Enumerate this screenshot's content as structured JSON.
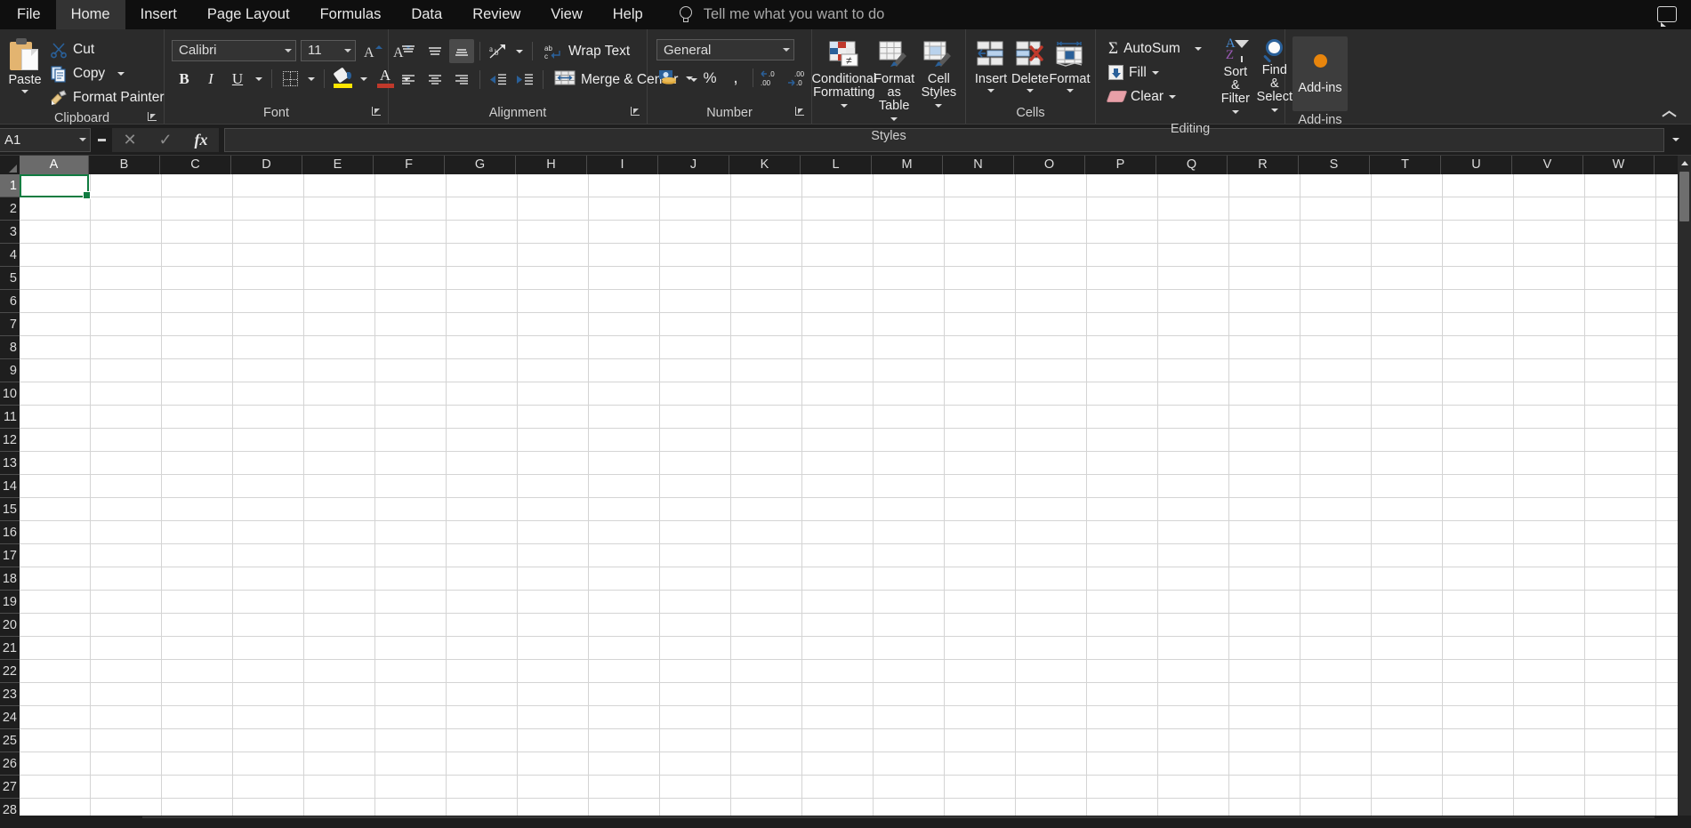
{
  "app": {
    "tabs": [
      {
        "label": "File",
        "active": false
      },
      {
        "label": "Home",
        "active": true
      },
      {
        "label": "Insert",
        "active": false
      },
      {
        "label": "Page Layout",
        "active": false
      },
      {
        "label": "Formulas",
        "active": false
      },
      {
        "label": "Data",
        "active": false
      },
      {
        "label": "Review",
        "active": false
      },
      {
        "label": "View",
        "active": false
      },
      {
        "label": "Help",
        "active": false
      }
    ],
    "tellme_placeholder": "Tell me what you want to do",
    "bulb_icon": "lightbulb-icon",
    "comment_icon": "comment-icon"
  },
  "ribbon": {
    "clipboard": {
      "group_label": "Clipboard",
      "paste_label": "Paste",
      "cut_label": "Cut",
      "copy_label": "Copy",
      "format_painter_label": "Format Painter",
      "dialog_launcher": "clipboard-dialog-launcher"
    },
    "font": {
      "group_label": "Font",
      "font_name": "Calibri",
      "font_size": "11",
      "grow_font": "A",
      "shrink_font": "A",
      "bold": "B",
      "italic": "I",
      "underline": "U",
      "border_icon": "borders-icon",
      "fill_color_icon": "fill-color-icon",
      "font_color_letter": "A",
      "dialog_launcher": "font-dialog-launcher"
    },
    "alignment": {
      "group_label": "Alignment",
      "wrap_text_label": "Wrap Text",
      "merge_center_label": "Merge & Center",
      "top_align": "align-top-icon",
      "middle_align": "align-middle-icon",
      "bottom_align": "align-bottom-icon",
      "align_left": "align-left-icon",
      "align_center": "align-center-icon",
      "align_right": "align-right-icon",
      "decrease_indent": "decrease-indent-icon",
      "increase_indent": "increase-indent-icon",
      "orientation": "orientation-icon",
      "dialog_launcher": "alignment-dialog-launcher"
    },
    "number": {
      "group_label": "Number",
      "format_value": "General",
      "accounting": "accounting-format-icon",
      "percent": "%",
      "comma": ",",
      "increase_decimal": "increase-decimal-icon",
      "decrease_decimal": "decrease-decimal-icon",
      "dialog_launcher": "number-dialog-launcher"
    },
    "styles": {
      "group_label": "Styles",
      "conditional_formatting": "Conditional Formatting",
      "conditional_formatting_l1": "Conditional",
      "conditional_formatting_l2": "Formatting",
      "format_as_table_l1": "Format as",
      "format_as_table_l2": "Table",
      "cell_styles_l1": "Cell",
      "cell_styles_l2": "Styles"
    },
    "cells": {
      "group_label": "Cells",
      "insert_label": "Insert",
      "delete_label": "Delete",
      "format_label": "Format"
    },
    "editing": {
      "group_label": "Editing",
      "autosum_label": "AutoSum",
      "fill_label": "Fill",
      "clear_label": "Clear",
      "sort_filter_l1": "Sort &",
      "sort_filter_l2": "Filter",
      "find_select_l1": "Find &",
      "find_select_l2": "Select"
    },
    "addins": {
      "group_label": "Add-ins",
      "button_label": "Add-ins"
    },
    "collapse_icon": "collapse-ribbon-icon"
  },
  "formula_bar": {
    "name_box_value": "A1",
    "cancel_icon": "cancel-icon",
    "enter_icon": "enter-icon",
    "fx_label": "fx",
    "formula_value": "",
    "expand_icon": "expand-formula-bar-icon"
  },
  "sheet": {
    "columns": [
      "A",
      "B",
      "C",
      "D",
      "E",
      "F",
      "G",
      "H",
      "I",
      "J",
      "K",
      "L",
      "M",
      "N",
      "O",
      "P",
      "Q",
      "R",
      "S",
      "T",
      "U",
      "V",
      "W"
    ],
    "selected_column": "A",
    "rows": [
      "1",
      "2",
      "3",
      "4",
      "5",
      "6",
      "7",
      "8",
      "9",
      "10",
      "11",
      "12",
      "13",
      "14",
      "15",
      "16",
      "17",
      "18",
      "19",
      "20",
      "21",
      "22",
      "23",
      "24",
      "25",
      "26",
      "27",
      "28"
    ],
    "selected_row": "1",
    "active_cell": "A1",
    "active_cell_value": "",
    "scroll_up_icon": "scroll-up-icon",
    "scroll_down_icon": "scroll-down-icon"
  },
  "colors": {
    "tabbar_bg": "#0f0f0f",
    "ribbon_bg": "#2b2b2b",
    "grid_bg": "#ffffff",
    "gridline": "#d4d4d4",
    "selection_green": "#107c41",
    "accent_blue": "#2a6099",
    "addin_orange": "#e8850c",
    "header_sel": "#6b6b6b"
  }
}
